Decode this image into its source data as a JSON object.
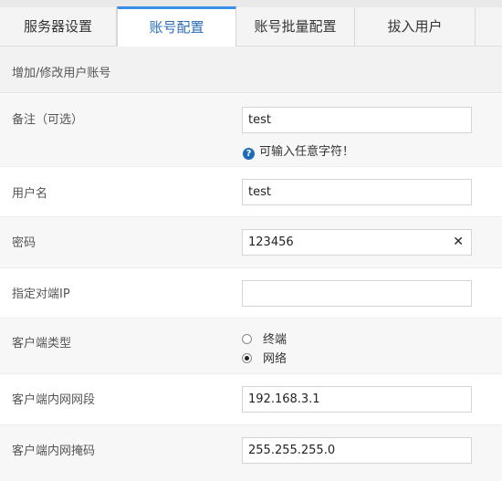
{
  "tabs": [
    {
      "label": "服务器设置"
    },
    {
      "label": "账号配置"
    },
    {
      "label": "账号批量配置"
    },
    {
      "label": "拔入用户"
    }
  ],
  "section_title": "增加/修改用户账号",
  "form": {
    "remark": {
      "label": "备注（可选）",
      "value": "test",
      "hint": "可输入任意字符！"
    },
    "username": {
      "label": "用户名",
      "value": "test"
    },
    "password": {
      "label": "密码",
      "value": "123456",
      "clear_glyph": "✕"
    },
    "peer_ip": {
      "label": "指定对端IP",
      "value": ""
    },
    "client_type": {
      "label": "客户端类型",
      "options": [
        "终端",
        "网络"
      ],
      "selected": "网络"
    },
    "lan_segment": {
      "label": "客户端内网网段",
      "value": "192.168.3.1"
    },
    "lan_mask": {
      "label": "客户端内网掩码",
      "value": "255.255.255.0"
    }
  },
  "icons": {
    "help": "question-circle-icon",
    "clear": "close-icon"
  },
  "colors": {
    "accent": "#3a8ee6",
    "active_tab_text": "#2c6cb8",
    "help_icon": "#1f6bb8"
  }
}
